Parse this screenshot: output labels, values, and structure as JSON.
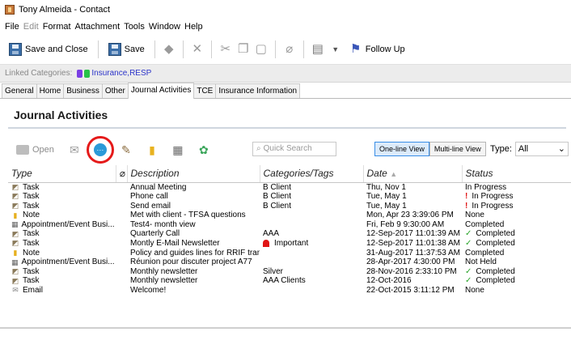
{
  "window": {
    "title": "Tony Almeida - Contact"
  },
  "menu": [
    {
      "label": "File",
      "disabled": false
    },
    {
      "label": "Edit",
      "disabled": true
    },
    {
      "label": "Format",
      "disabled": false
    },
    {
      "label": "Attachment",
      "disabled": false
    },
    {
      "label": "Tools",
      "disabled": false
    },
    {
      "label": "Window",
      "disabled": false
    },
    {
      "label": "Help",
      "disabled": false
    }
  ],
  "toolbar": {
    "save_close": "Save and Close",
    "save": "Save",
    "follow_up": "Follow Up"
  },
  "linked": {
    "label": "Linked Categories:",
    "value": "Insurance,RESP"
  },
  "tabs": [
    "General",
    "Home",
    "Business",
    "Other",
    "Journal Activities",
    "TCE",
    "Insurance Information"
  ],
  "active_tab": "Journal Activities",
  "section": {
    "title": "Journal Activities"
  },
  "actions": {
    "open": "Open",
    "search_placeholder": "Quick Search",
    "one_line_view": "One-line View",
    "multi_line_view": "Multi-line View",
    "type_label": "Type:",
    "type_value": "All"
  },
  "table": {
    "columns": [
      "Type",
      "Description",
      "Categories/Tags",
      "Date",
      "Status"
    ],
    "rows": [
      {
        "type": "Task",
        "icon": "task",
        "description": "Annual Meeting",
        "category": "B Client",
        "category_important": false,
        "date": "Thu, Nov 1",
        "status": "In Progress",
        "status_icon": ""
      },
      {
        "type": "Task",
        "icon": "task",
        "description": "Phone call",
        "category": "B Client",
        "category_important": false,
        "date": "Tue, May 1",
        "status": "In Progress",
        "status_icon": "!"
      },
      {
        "type": "Task",
        "icon": "task",
        "description": "Send email",
        "category": "B Client",
        "category_important": false,
        "date": "Tue, May 1",
        "status": "In Progress",
        "status_icon": "!"
      },
      {
        "type": "Note",
        "icon": "note",
        "description": "Met with client - TFSA questions",
        "category": "",
        "category_important": false,
        "date": "Mon, Apr 23 3:39:06 PM",
        "status": "None",
        "status_icon": ""
      },
      {
        "type": "Appointment/Event Busi...",
        "icon": "appt",
        "description": "Test4- month view",
        "category": "",
        "category_important": false,
        "date": "Fri, Feb 9 9:30:00 AM",
        "status": "Completed",
        "status_icon": ""
      },
      {
        "type": "Task",
        "icon": "task",
        "description": "Quarterly Call",
        "category": "AAA",
        "category_important": false,
        "date": "12-Sep-2017 11:01:39 AM",
        "status": "Completed",
        "status_icon": "✓"
      },
      {
        "type": "Task",
        "icon": "task",
        "description": "Montly E-Mail Newsletter",
        "category": "Important",
        "category_important": true,
        "date": "12-Sep-2017 11:01:38 AM",
        "status": "Completed",
        "status_icon": "✓"
      },
      {
        "type": "Note",
        "icon": "note",
        "description": "Policy and guides lines for RRIF transfers",
        "category": "",
        "category_important": false,
        "date": "31-Aug-2017 11:37:53 AM",
        "status": "Completed",
        "status_icon": ""
      },
      {
        "type": "Appointment/Event Busi...",
        "icon": "appt",
        "description": "Réunion pour discuter project A77",
        "category": "",
        "category_important": false,
        "date": "28-Apr-2017 4:30:00 PM",
        "status": "Not Held",
        "status_icon": ""
      },
      {
        "type": "Task",
        "icon": "task",
        "description": "Monthly newsletter",
        "category": "Silver",
        "category_important": false,
        "date": "28-Nov-2016 2:33:10 PM",
        "status": "Completed",
        "status_icon": "✓"
      },
      {
        "type": "Task",
        "icon": "task",
        "description": "Monthly newsletter",
        "category": "AAA Clients",
        "category_important": false,
        "date": "12-Oct-2016",
        "status": "Completed",
        "status_icon": "✓"
      },
      {
        "type": "Email",
        "icon": "email",
        "description": "Welcome!",
        "category": "",
        "category_important": false,
        "date": "22-Oct-2015 3:11:12 PM",
        "status": "None",
        "status_icon": ""
      }
    ]
  }
}
